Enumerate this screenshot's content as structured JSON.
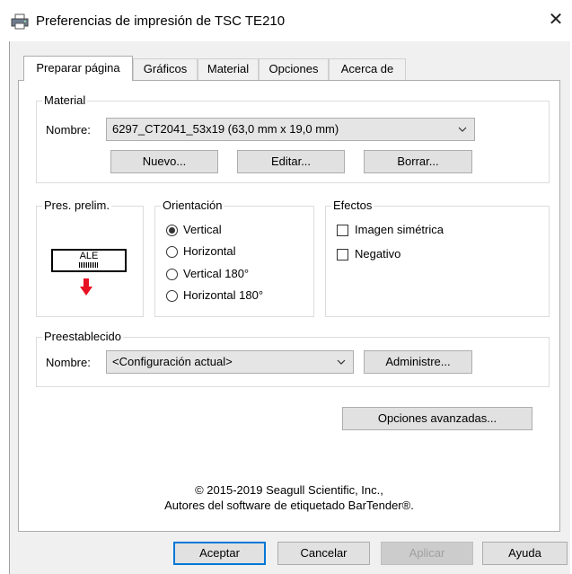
{
  "window": {
    "title": "Preferencias de impresión de TSC TE210",
    "close_label": "✕"
  },
  "tabs": [
    {
      "label": "Preparar página",
      "active": true
    },
    {
      "label": "Gráficos"
    },
    {
      "label": "Material"
    },
    {
      "label": "Opciones"
    },
    {
      "label": "Acerca de"
    }
  ],
  "material": {
    "group_label": "Material",
    "name_label": "Nombre:",
    "name_value": "6297_CT2041_53x19 (63,0 mm x 19,0 mm)",
    "buttons": {
      "new": "Nuevo...",
      "edit": "Editar...",
      "delete": "Borrar..."
    }
  },
  "preview": {
    "group_label": "Pres. prelim.",
    "label_text": "ALE",
    "icons": {
      "barcode": "barcode-icon",
      "arrow": "down-arrow-icon"
    },
    "arrow_color": "#e81123"
  },
  "orientation": {
    "group_label": "Orientación",
    "options": [
      {
        "label": "Vertical",
        "selected": true
      },
      {
        "label": "Horizontal",
        "selected": false
      },
      {
        "label": "Vertical 180°",
        "selected": false
      },
      {
        "label": "Horizontal 180°",
        "selected": false
      }
    ]
  },
  "effects": {
    "group_label": "Efectos",
    "options": [
      {
        "label": "Imagen simétrica",
        "checked": false
      },
      {
        "label": "Negativo",
        "checked": false
      }
    ]
  },
  "preset": {
    "group_label": "Preestablecido",
    "name_label": "Nombre:",
    "name_value": "<Configuración actual>",
    "manage_button": "Administre..."
  },
  "advanced_button": "Opciones avanzadas...",
  "copyright": {
    "line1": "© 2015-2019 Seagull Scientific, Inc.,",
    "line2": "Autores del software de etiquetado BarTender®."
  },
  "footer": {
    "ok": "Aceptar",
    "cancel": "Cancelar",
    "apply": "Aplicar",
    "help": "Ayuda"
  },
  "colors": {
    "accent": "#0078d7",
    "disabled_text": "#a0a0a0"
  }
}
